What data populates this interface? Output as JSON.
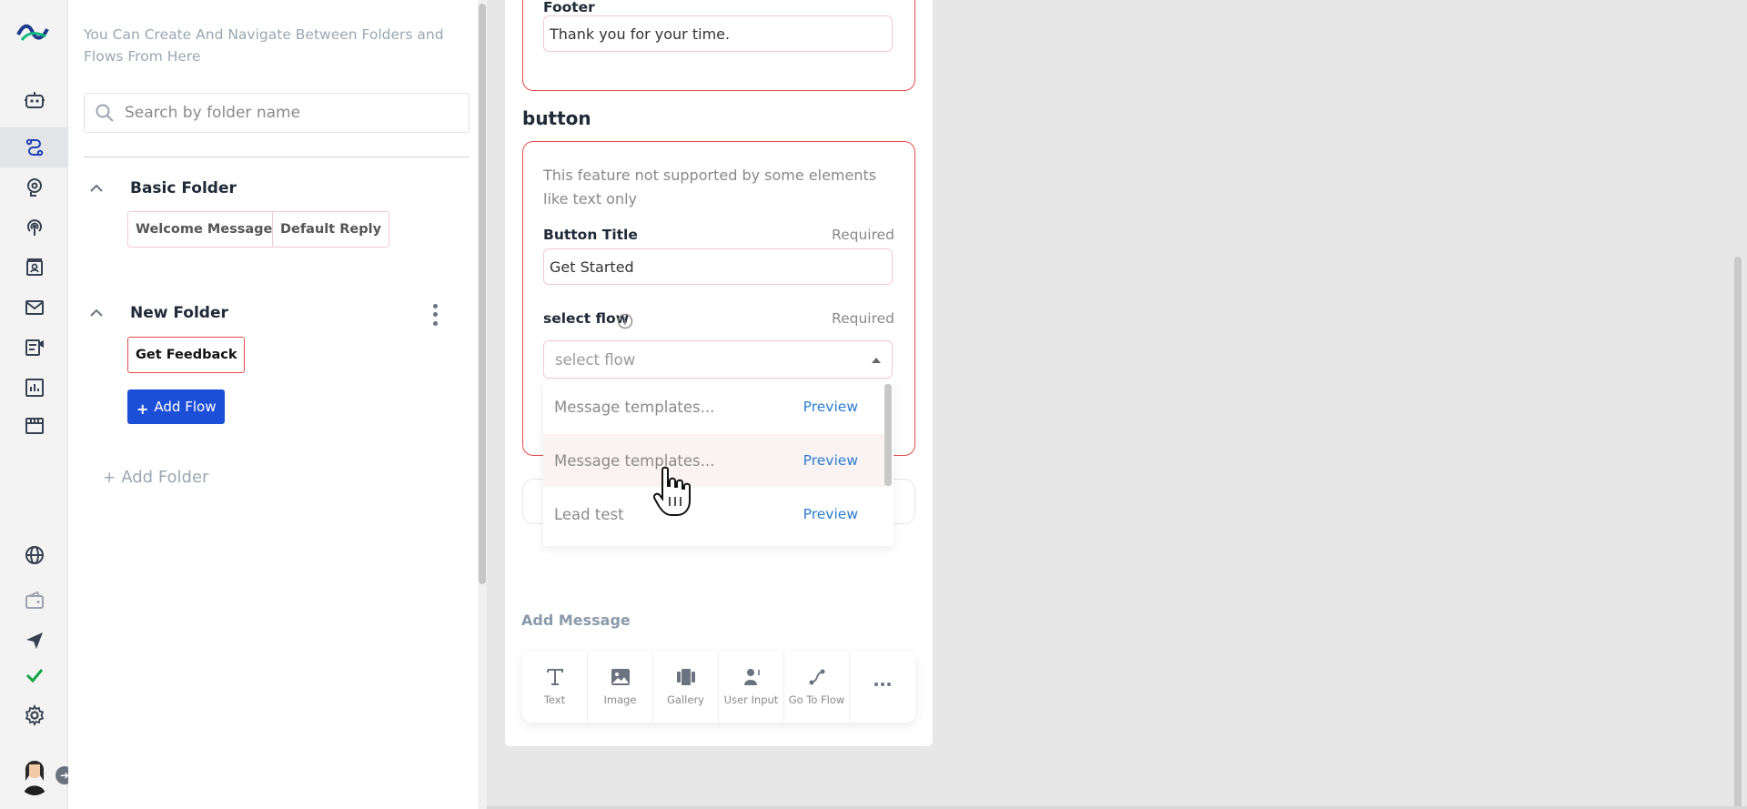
{
  "sidebar": {
    "icons": [
      "logo-icon",
      "bot-icon",
      "flows-icon",
      "brain-icon",
      "broadcast-icon",
      "contacts-icon",
      "mail-icon",
      "campaign-icon",
      "analytics-icon",
      "store-icon",
      "globe-icon",
      "wallet-icon",
      "send-icon",
      "check-icon",
      "gear-icon"
    ]
  },
  "folders_panel": {
    "help_text": "You Can Create And Navigate Between Folders and Flows From Here",
    "search_placeholder": "Search by folder name",
    "folders": [
      {
        "name": "Basic Folder",
        "flows": [
          "Welcome Message",
          "Default Reply"
        ]
      },
      {
        "name": "New Folder",
        "flows": [
          "Get Feedback"
        ]
      }
    ],
    "add_flow_label": "Add Flow",
    "add_folder_label": "Add Folder"
  },
  "editor": {
    "footer_label": "Footer",
    "footer_value": "Thank you for your time.",
    "button_section_title": "button",
    "button_note": "This feature not supported by some elements like text only",
    "button_title_label": "Button Title",
    "required_text": "Required",
    "button_title_value": "Get Started",
    "select_flow_label": "select flow",
    "select_flow_placeholder": "select flow",
    "dropdown_options": [
      {
        "label": "Message templates...",
        "action": "Preview"
      },
      {
        "label": "Message templates...",
        "action": "Preview"
      },
      {
        "label": "Lead test",
        "action": "Preview"
      }
    ],
    "add_message_label": "Add Message",
    "tools": [
      {
        "label": "Text"
      },
      {
        "label": "Image"
      },
      {
        "label": "Gallery"
      },
      {
        "label": "User Input"
      },
      {
        "label": "Go To Flow"
      },
      {
        "label": ""
      }
    ]
  },
  "colors": {
    "accent": "#1d4ed8",
    "error_border": "#e24c4c",
    "link": "#2b7ccf",
    "check": "#16a34a"
  }
}
